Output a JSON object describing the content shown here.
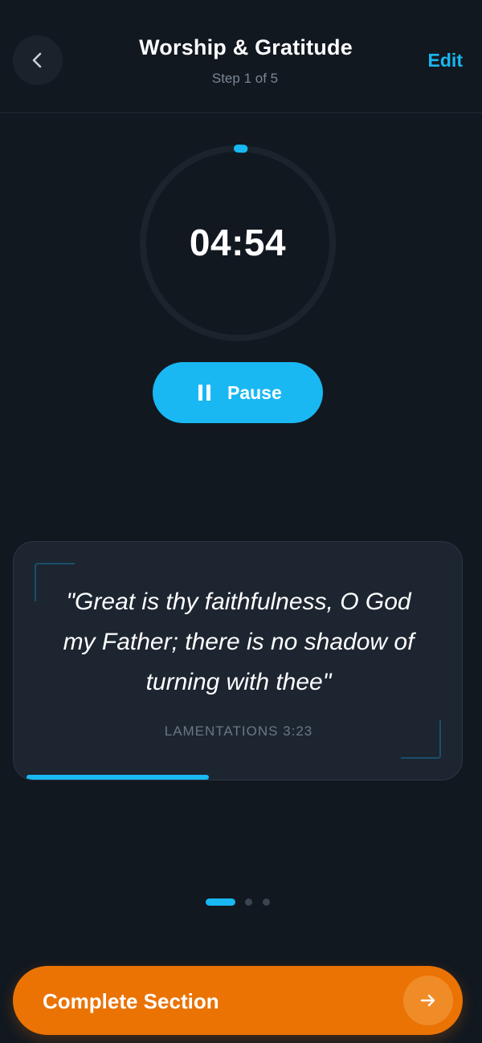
{
  "header": {
    "title": "Worship & Gratitude",
    "subtitle": "Step 1 of 5",
    "edit_label": "Edit",
    "back_icon": "chevron-left-icon"
  },
  "timer": {
    "display": "04:54",
    "progress_fraction": 0.02
  },
  "controls": {
    "pause_label": "Pause",
    "pause_icon": "pause-icon"
  },
  "quote": {
    "text": "\"Great is thy faithfulness, O God my Father; there is no shadow of turning with thee\"",
    "reference": "LAMENTATIONS 3:23",
    "progress_fraction": 0.43
  },
  "pager": {
    "total": 3,
    "active_index": 0
  },
  "footer": {
    "complete_label": "Complete Section",
    "arrow_icon": "arrow-right-icon"
  },
  "colors": {
    "background": "#111820",
    "accent": "#19b8f3",
    "primary_action": "#ea7304",
    "card": "#1c2530"
  }
}
